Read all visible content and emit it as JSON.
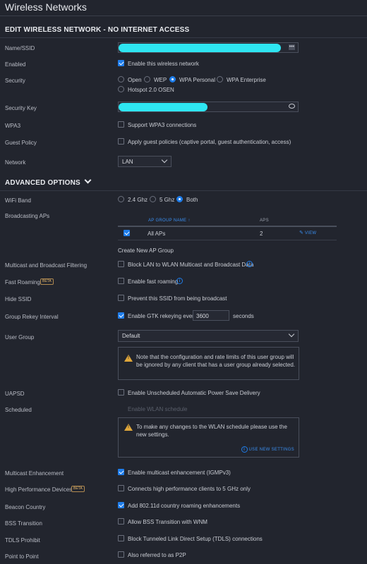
{
  "header": {
    "title": "Wireless Networks"
  },
  "edit_section": {
    "title": "EDIT WIRELESS NETWORK - NO INTERNET ACCESS"
  },
  "fields": {
    "name_label": "Name/SSID",
    "enabled_label": "Enabled",
    "enabled_text": "Enable this wireless network",
    "security_label": "Security",
    "security_options": [
      "Open",
      "WEP",
      "WPA Personal",
      "WPA Enterprise",
      "Hotspot 2.0 OSEN"
    ],
    "security_selected": "WPA Personal",
    "security_key_label": "Security Key",
    "wpa3_label": "WPA3",
    "wpa3_text": "Support WPA3 connections",
    "guest_label": "Guest Policy",
    "guest_text": "Apply guest policies (captive portal, guest authentication, access)",
    "network_label": "Network",
    "network_value": "LAN"
  },
  "advanced": {
    "title": "ADVANCED OPTIONS",
    "wifi_band_label": "WiFi Band",
    "wifi_band_options": [
      "2.4 Ghz",
      "5 Ghz",
      "Both"
    ],
    "wifi_band_selected": "Both",
    "broadcasting_label": "Broadcasting APs",
    "table": {
      "headers": [
        "AP GROUP NAME",
        "APS"
      ],
      "rows": [
        {
          "name": "All APs",
          "aps": "2",
          "action": "VIEW"
        }
      ]
    },
    "create_group": "Create New AP Group",
    "multicast_filter_label": "Multicast and Broadcast Filtering",
    "multicast_filter_text": "Block LAN to WLAN Multicast and Broadcast Data",
    "fast_roaming_label": "Fast Roaming",
    "beta": "BETA",
    "fast_roaming_text": "Enable fast roaming",
    "hide_ssid_label": "Hide SSID",
    "hide_ssid_text": "Prevent this SSID from being broadcast",
    "rekey_label": "Group Rekey Interval",
    "rekey_text": "Enable GTK rekeying every",
    "rekey_value": "3600",
    "rekey_unit": "seconds",
    "user_group_label": "User Group",
    "user_group_value": "Default",
    "user_group_notice": "Note that the configuration and rate limits of this user group will be ignored by any client that has a user group already selected.",
    "uapsd_label": "UAPSD",
    "uapsd_text": "Enable Unscheduled Automatic Power Save Delivery",
    "scheduled_label": "Scheduled",
    "scheduled_text": "Enable WLAN schedule",
    "schedule_notice": "To make any changes to the WLAN schedule please use the new settings.",
    "use_new_settings": "USE NEW SETTINGS",
    "multicast_enh_label": "Multicast Enhancement",
    "multicast_enh_text": "Enable multicast enhancement (IGMPv3)",
    "hpd_label": "High Performance Devices",
    "hpd_text": "Connects high performance clients to 5 GHz only",
    "beacon_label": "Beacon Country",
    "beacon_text": "Add 802.11d country roaming enhancements",
    "bss_label": "BSS Transition",
    "bss_text": "Allow BSS Transition with WNM",
    "tdls_label": "TDLS Prohibit",
    "tdls_text": "Block Tunneled Link Direct Setup (TDLS) connections",
    "p2p_label": "Point to Point",
    "p2p_text": "Also referred to as P2P"
  },
  "colors": {
    "accent": "#1f7dea",
    "background": "#22252e",
    "warning": "#e0a73a",
    "redaction": "#2ee6f2"
  }
}
